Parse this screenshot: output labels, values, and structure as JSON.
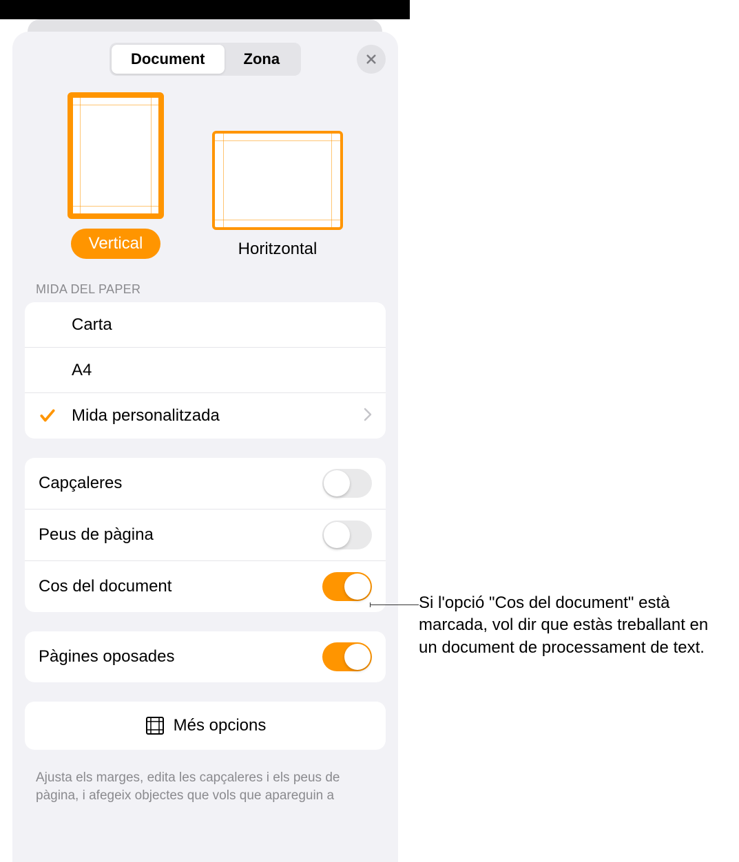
{
  "tabs": {
    "document": "Document",
    "zona": "Zona"
  },
  "orientation": {
    "vertical": "Vertical",
    "horizontal": "Horitzontal"
  },
  "paperSize": {
    "header": "MIDA DEL PAPER",
    "options": {
      "carta": "Carta",
      "a4": "A4",
      "custom": "Mida personalitzada"
    }
  },
  "toggles": {
    "headers": "Capçaleres",
    "footers": "Peus de pàgina",
    "documentBody": "Cos del document",
    "facingPages": "Pàgines oposades"
  },
  "moreOptions": "Més opcions",
  "footerNote": "Ajusta els marges, edita les capçaleres i els peus de pàgina, i afegeix objectes que vols que apareguin a",
  "callout": "Si l'opció \"Cos del document\" està marcada, vol dir que estàs treballant en un document de processament de text."
}
